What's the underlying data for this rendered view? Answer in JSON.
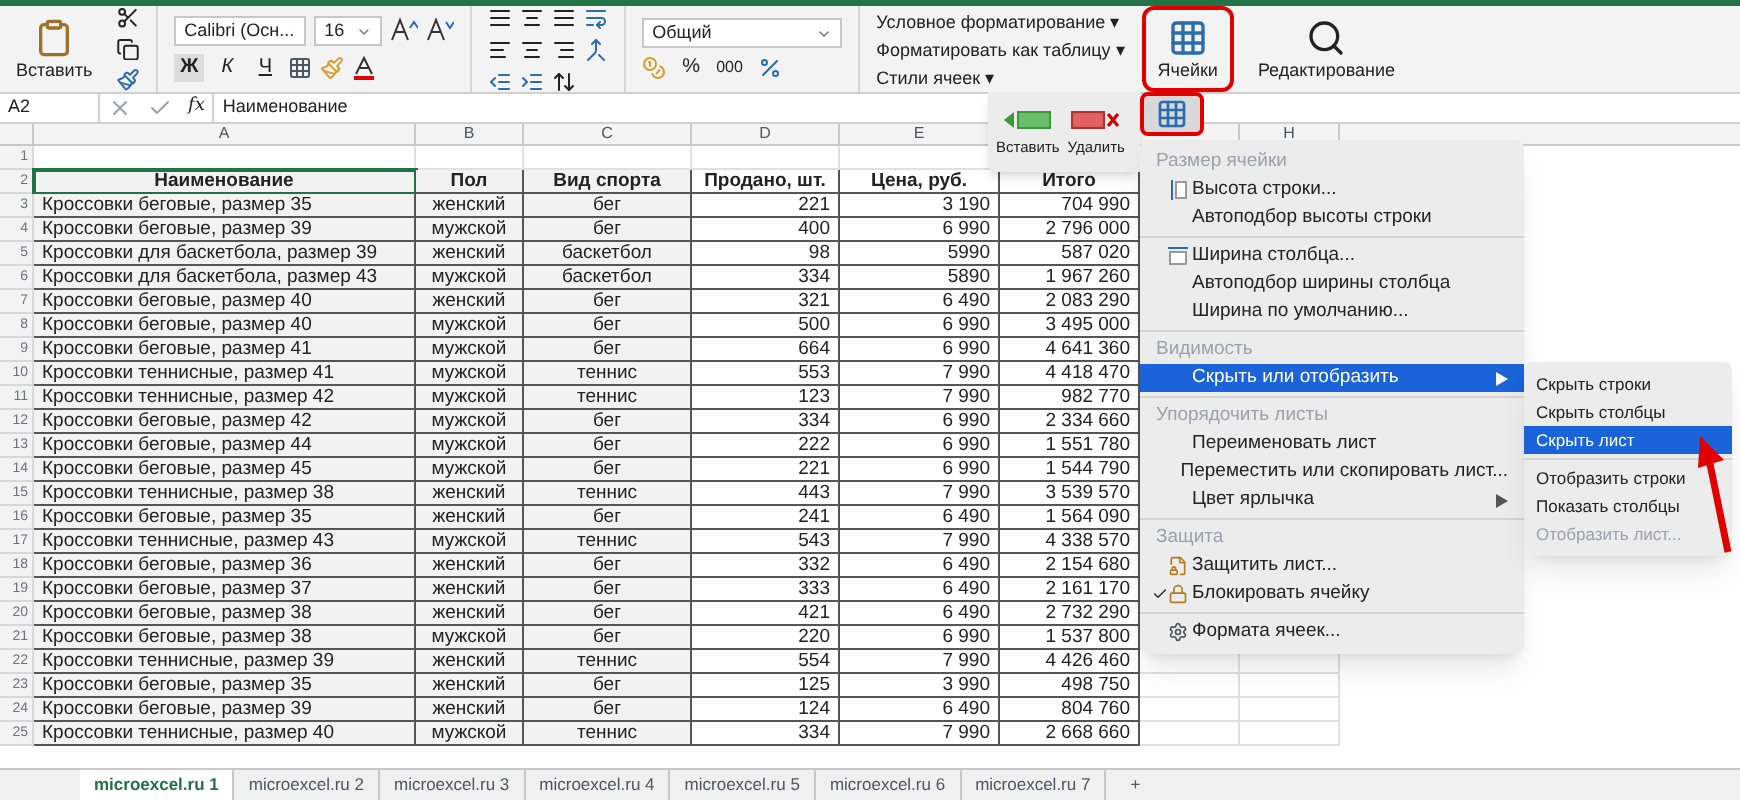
{
  "ribbon": {
    "paste_label": "Вставить",
    "font_name": "Calibri (Осн...",
    "font_size": "16",
    "bold_key": "Ж",
    "italic_key": "К",
    "underline_key": "Ч",
    "number_format": "Общий",
    "percent": "%",
    "thousands": "000",
    "styles": [
      {
        "label": "Условное форматирование ▾"
      },
      {
        "label": "Форматировать как таблицу ▾"
      },
      {
        "label": "Стили ячеек ▾"
      }
    ],
    "cells_label": "Ячейки",
    "cells_highlighted": true,
    "editing_label": "Редактирование"
  },
  "formula_bar": {
    "name_box": "A2",
    "fx": "fx",
    "value": "Наименование"
  },
  "cells_popup": {
    "buttons": [
      {
        "label": "Вставить",
        "kind": "insert"
      },
      {
        "label": "Удалить",
        "kind": "delete"
      }
    ],
    "format_highlighted": true
  },
  "columns": [
    {
      "letter": "A"
    },
    {
      "letter": "B"
    },
    {
      "letter": "C"
    },
    {
      "letter": "D"
    },
    {
      "letter": "E"
    },
    {},
    {},
    {
      "letter": "H"
    }
  ],
  "table": {
    "rows": [
      {
        "row": "1",
        "kind": "empty"
      },
      {
        "row": "2",
        "kind": "header",
        "cells": [
          {
            "text": "Наименование",
            "selected": true
          },
          {
            "text": "Пол",
            "selected": false
          },
          {
            "text": "Вид спорта",
            "selected": false
          },
          {
            "text": "Продано, шт.",
            "selected": false
          },
          {
            "text": "Цена, руб.",
            "selected": false
          },
          {
            "text": "Итого",
            "selected": false
          }
        ]
      },
      {
        "row": "3",
        "kind": "data",
        "cells": [
          "Кроссовки беговые, размер 35",
          "женский",
          "бег",
          "221",
          "3 190",
          "704 990"
        ]
      },
      {
        "row": "4",
        "kind": "data",
        "cells": [
          "Кроссовки беговые, размер 39",
          "мужской",
          "бег",
          "400",
          "6 990",
          "2 796 000"
        ]
      },
      {
        "row": "5",
        "kind": "data",
        "cells": [
          "Кроссовки для баскетбола, размер 39",
          "женский",
          "баскетбол",
          "98",
          "5990",
          "587 020"
        ]
      },
      {
        "row": "6",
        "kind": "data",
        "cells": [
          "Кроссовки для баскетбола, размер 43",
          "мужской",
          "баскетбол",
          "334",
          "5890",
          "1 967 260"
        ]
      },
      {
        "row": "7",
        "kind": "data",
        "cells": [
          "Кроссовки беговые, размер 40",
          "женский",
          "бег",
          "321",
          "6 490",
          "2 083 290"
        ]
      },
      {
        "row": "8",
        "kind": "data",
        "cells": [
          "Кроссовки беговые, размер 40",
          "мужской",
          "бег",
          "500",
          "6 990",
          "3 495 000"
        ]
      },
      {
        "row": "9",
        "kind": "data",
        "cells": [
          "Кроссовки беговые, размер 41",
          "мужской",
          "бег",
          "664",
          "6 990",
          "4 641 360"
        ]
      },
      {
        "row": "10",
        "kind": "data",
        "cells": [
          "Кроссовки теннисные, размер 41",
          "мужской",
          "теннис",
          "553",
          "7 990",
          "4 418 470"
        ]
      },
      {
        "row": "11",
        "kind": "data",
        "cells": [
          "Кроссовки теннисные, размер 42",
          "мужской",
          "теннис",
          "123",
          "7 990",
          "982 770"
        ]
      },
      {
        "row": "12",
        "kind": "data",
        "cells": [
          "Кроссовки беговые, размер 42",
          "мужской",
          "бег",
          "334",
          "6 990",
          "2 334 660"
        ]
      },
      {
        "row": "13",
        "kind": "data",
        "cells": [
          "Кроссовки беговые, размер 44",
          "мужской",
          "бег",
          "222",
          "6 990",
          "1 551 780"
        ]
      },
      {
        "row": "14",
        "kind": "data",
        "cells": [
          "Кроссовки беговые, размер 45",
          "мужской",
          "бег",
          "221",
          "6 990",
          "1 544 790"
        ]
      },
      {
        "row": "15",
        "kind": "data",
        "cells": [
          "Кроссовки теннисные, размер 38",
          "женский",
          "теннис",
          "443",
          "7 990",
          "3 539 570"
        ]
      },
      {
        "row": "16",
        "kind": "data",
        "cells": [
          "Кроссовки беговые, размер 35",
          "женский",
          "бег",
          "241",
          "6 490",
          "1 564 090"
        ]
      },
      {
        "row": "17",
        "kind": "data",
        "cells": [
          "Кроссовки теннисные, размер 43",
          "мужской",
          "теннис",
          "543",
          "7 990",
          "4 338 570"
        ]
      },
      {
        "row": "18",
        "kind": "data",
        "cells": [
          "Кроссовки беговые, размер 36",
          "женский",
          "бег",
          "332",
          "6 490",
          "2 154 680"
        ]
      },
      {
        "row": "19",
        "kind": "data",
        "cells": [
          "Кроссовки беговые, размер 37",
          "женский",
          "бег",
          "333",
          "6 490",
          "2 161 170"
        ]
      },
      {
        "row": "20",
        "kind": "data",
        "cells": [
          "Кроссовки беговые, размер 38",
          "женский",
          "бег",
          "421",
          "6 490",
          "2 732 290"
        ]
      },
      {
        "row": "21",
        "kind": "data",
        "cells": [
          "Кроссовки беговые, размер 38",
          "мужской",
          "бег",
          "220",
          "6 990",
          "1 537 800"
        ]
      },
      {
        "row": "22",
        "kind": "data",
        "cells": [
          "Кроссовки теннисные, размер 39",
          "женский",
          "теннис",
          "554",
          "7 990",
          "4 426 460"
        ]
      },
      {
        "row": "23",
        "kind": "data",
        "cells": [
          "Кроссовки беговые, размер 35",
          "женский",
          "бег",
          "125",
          "3 990",
          "498 750"
        ]
      },
      {
        "row": "24",
        "kind": "data",
        "cells": [
          "Кроссовки беговые, размер 39",
          "женский",
          "бег",
          "124",
          "6 490",
          "804 760"
        ]
      },
      {
        "row": "25",
        "kind": "data",
        "cells": [
          "Кроссовки теннисные, размер 40",
          "мужской",
          "теннис",
          "334",
          "7 990",
          "2 668 660"
        ]
      }
    ]
  },
  "context_menu": {
    "sections": [
      {
        "heading": "Размер ячейки",
        "items": [
          {
            "label": "Высота строки...",
            "selected": false,
            "submenu": false,
            "checked": false
          },
          {
            "label": "Автоподбор высоты строки",
            "selected": false,
            "submenu": false,
            "checked": false
          }
        ]
      },
      {
        "items": [
          {
            "label": "Ширина столбца...",
            "selected": false,
            "submenu": false,
            "checked": false
          },
          {
            "label": "Автоподбор ширины столбца",
            "selected": false,
            "submenu": false,
            "checked": false
          },
          {
            "label": "Ширина по умолчанию...",
            "selected": false,
            "submenu": false,
            "checked": false
          }
        ]
      },
      {
        "heading": "Видимость",
        "items": [
          {
            "label": "Скрыть или отобразить",
            "selected": true,
            "submenu": true,
            "checked": false
          }
        ]
      },
      {
        "heading": "Упорядочить листы",
        "items": [
          {
            "label": "Переименовать лист",
            "selected": false,
            "submenu": false,
            "checked": false
          },
          {
            "label": "Переместить или скопировать лист...",
            "selected": false,
            "submenu": false,
            "checked": false
          },
          {
            "label": "Цвет ярлычка",
            "selected": false,
            "submenu": true,
            "checked": false
          }
        ]
      },
      {
        "heading": "Защита",
        "items": [
          {
            "label": "Защитить лист...",
            "selected": false,
            "submenu": false,
            "checked": false
          },
          {
            "label": "Блокировать ячейку",
            "selected": false,
            "submenu": false,
            "checked": true
          }
        ]
      },
      {
        "items": [
          {
            "label": "Формата ячеек...",
            "selected": false,
            "submenu": false,
            "checked": false
          }
        ]
      }
    ]
  },
  "submenu": {
    "groups": [
      [
        {
          "label": "Скрыть строки",
          "selected": false,
          "disabled": false
        },
        {
          "label": "Скрыть столбцы",
          "selected": false,
          "disabled": false
        },
        {
          "label": "Скрыть лист",
          "selected": true,
          "disabled": false
        }
      ],
      [
        {
          "label": "Отобразить строки",
          "selected": false,
          "disabled": false
        },
        {
          "label": "Показать столбцы",
          "selected": false,
          "disabled": false
        },
        {
          "label": "Отобразить лист...",
          "selected": false,
          "disabled": true
        }
      ]
    ]
  },
  "sheet_tabs": [
    {
      "label": "microexcel.ru 1",
      "selected": true
    },
    {
      "label": "microexcel.ru 2",
      "selected": false
    },
    {
      "label": "microexcel.ru 3",
      "selected": false
    },
    {
      "label": "microexcel.ru 4",
      "selected": false
    },
    {
      "label": "microexcel.ru 5",
      "selected": false
    },
    {
      "label": "microexcel.ru 6",
      "selected": false
    },
    {
      "label": "microexcel.ru 7",
      "selected": false
    }
  ],
  "add_sheet": "+"
}
